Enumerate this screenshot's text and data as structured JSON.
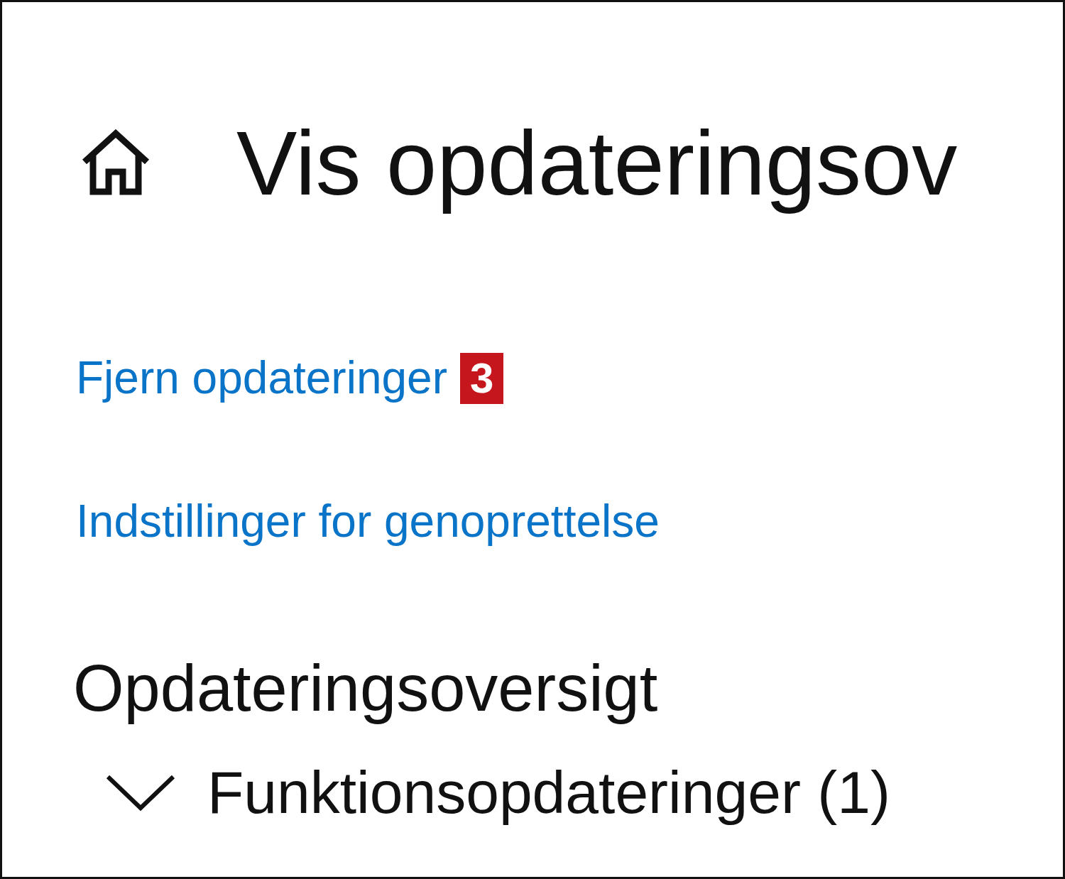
{
  "header": {
    "title": "Vis opdateringsov"
  },
  "links": [
    {
      "label": "Fjern opdateringer",
      "badge": "3"
    },
    {
      "label": "Indstillinger for genoprettelse"
    }
  ],
  "section": {
    "title": "Opdateringsoversigt"
  },
  "groups": [
    {
      "label": "Funktionsopdateringer (1)",
      "expanded": true
    }
  ]
}
